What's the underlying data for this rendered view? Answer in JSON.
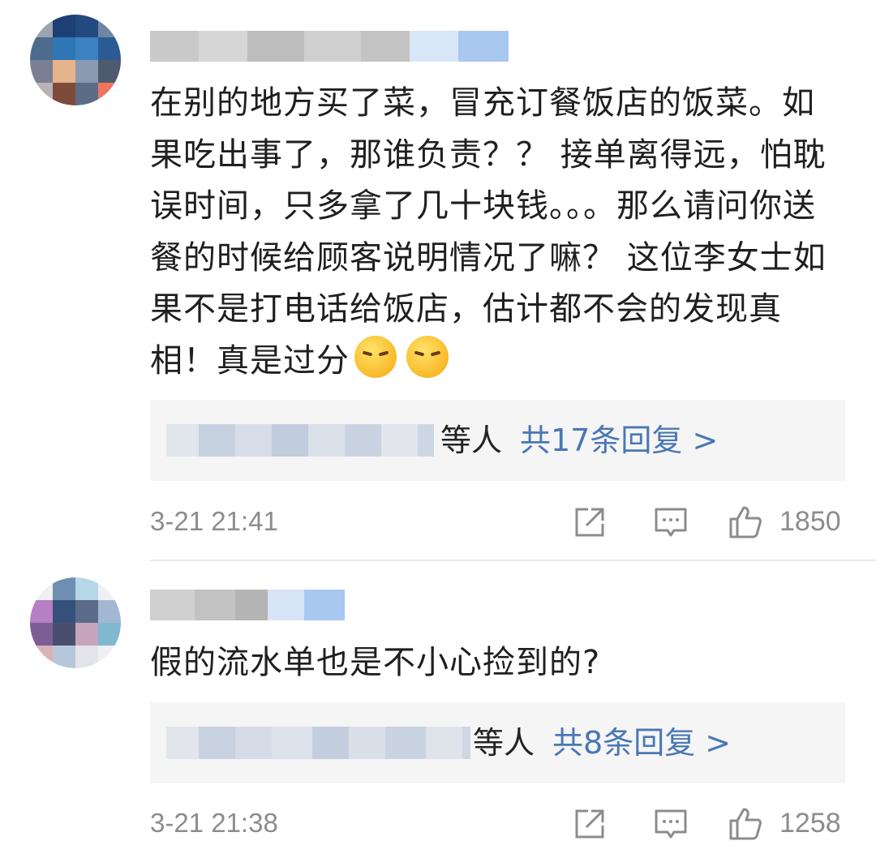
{
  "comments": [
    {
      "content": "在别的地方买了菜，冒充订餐饭店的饭菜。如果吃出事了，那谁负责？？ 接单离得远，怕耽误时间，只多拿了几十块钱。。。那么请问你送餐的时候给顾客说明情况了嘛？ 这位李女士如果不是打电话给饭店，估计都不会的发现真相！真是过分",
      "emoji": [
        "angry-face-emoji",
        "angry-face-emoji"
      ],
      "replies_others": "等人",
      "replies_count": "共17条回复 >",
      "time": "3-21 21:41",
      "likes": "1850"
    },
    {
      "content": "假的流水单也是不小心捡到的?",
      "replies_others": "等人",
      "replies_count": "共8条回复 >",
      "time": "3-21 21:38",
      "likes": "1258"
    }
  ],
  "colors": {
    "link": "#4a77b4",
    "meta": "#8c8c8c",
    "reply_bg": "#f5f5f5"
  },
  "icons": {
    "share": "share-icon",
    "comment": "comment-icon",
    "like": "like-icon"
  }
}
